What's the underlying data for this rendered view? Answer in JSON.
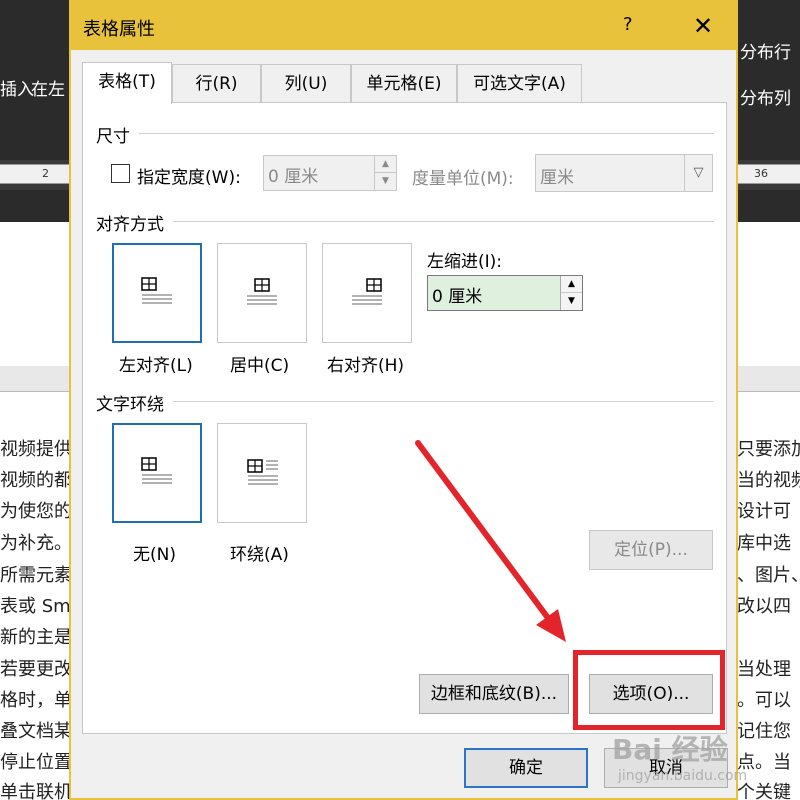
{
  "background": {
    "ribbon_left_labels": [
      "插入",
      "在左"
    ],
    "ribbon_right_labels": [
      "分布行",
      "分布列"
    ],
    "ruler_ticks": [
      "2",
      "36"
    ],
    "doc_lines_left": [
      "视频提供",
      "视频的都",
      "为使您的",
      "为补充。",
      "所需元素",
      "表或 Sm",
      "新的主是",
      "若要更改",
      "格时，单",
      "叠文档某",
      "停止位置",
      "单击联机"
    ],
    "doc_lines_right": [
      "只要添加",
      "当的视频",
      "设计可",
      "库中选",
      "、图片、",
      "改以四",
      "",
      "当处理",
      "。可以",
      "记住您",
      "点。当",
      "个关键"
    ]
  },
  "dialog": {
    "title": "表格属性",
    "help": "?",
    "close": "✕",
    "tabs": [
      "表格(T)",
      "行(R)",
      "列(U)",
      "单元格(E)",
      "可选文字(A)"
    ],
    "size_section": {
      "label": "尺寸",
      "specify_width_label": "指定宽度(W):",
      "width_value": "0 厘米",
      "unit_label": "度量单位(M):",
      "unit_value": "厘米"
    },
    "alignment_section": {
      "label": "对齐方式",
      "options": [
        "左对齐(L)",
        "居中(C)",
        "右对齐(H)"
      ],
      "indent_label": "左缩进(I):",
      "indent_value": "0 厘米"
    },
    "wrap_section": {
      "label": "文字环绕",
      "options": [
        "无(N)",
        "环绕(A)"
      ],
      "position_button": "定位(P)..."
    },
    "borders_button": "边框和底纹(B)...",
    "options_button": "选项(O)...",
    "ok_button": "确定",
    "cancel_button": "取消"
  },
  "watermark": {
    "brand": "Bai 经验",
    "url": "jingyan.baidu.com"
  },
  "colors": {
    "title_bar": "#e8c23b",
    "selection_border": "#1e6fb5",
    "annotation_red": "#e3242b",
    "indent_field_bg": "#dff0df"
  }
}
